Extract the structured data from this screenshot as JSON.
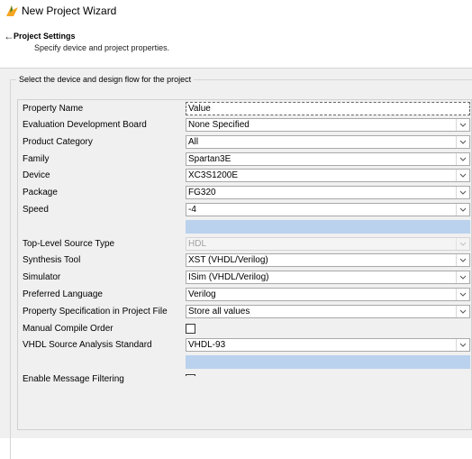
{
  "window": {
    "title": "New Project Wizard",
    "icon": "xilinx-wizard-icon",
    "accent": "#f5a623"
  },
  "header": {
    "back_icon": "back-arrow-icon",
    "title": "Project Settings",
    "subtitle": "Specify device and project properties."
  },
  "group": {
    "legend": "Select the device and design flow for the project"
  },
  "grid": {
    "column_headers": {
      "name": "Property Name",
      "value": "Value"
    },
    "rows": [
      {
        "name": "Evaluation Development Board",
        "value": "None Specified",
        "kind": "dropdown"
      },
      {
        "name": "Product Category",
        "value": "All",
        "kind": "dropdown"
      },
      {
        "name": "Family",
        "value": "Spartan3E",
        "kind": "dropdown"
      },
      {
        "name": "Device",
        "value": "XC3S1200E",
        "kind": "dropdown"
      },
      {
        "name": "Package",
        "value": "FG320",
        "kind": "dropdown"
      },
      {
        "name": "Speed",
        "value": "-4",
        "kind": "dropdown"
      },
      {
        "name": "",
        "value": "",
        "kind": "spacer"
      },
      {
        "name": "Top-Level Source Type",
        "value": "HDL",
        "kind": "dropdown-disabled"
      },
      {
        "name": "Synthesis Tool",
        "value": "XST (VHDL/Verilog)",
        "kind": "dropdown"
      },
      {
        "name": "Simulator",
        "value": "ISim (VHDL/Verilog)",
        "kind": "dropdown"
      },
      {
        "name": "Preferred Language",
        "value": "Verilog",
        "kind": "dropdown"
      },
      {
        "name": "Property Specification in Project File",
        "value": "Store all values",
        "kind": "dropdown"
      },
      {
        "name": "Manual Compile Order",
        "value": false,
        "kind": "checkbox"
      },
      {
        "name": "VHDL Source Analysis Standard",
        "value": "VHDL-93",
        "kind": "dropdown"
      },
      {
        "name": "",
        "value": "",
        "kind": "spacer"
      },
      {
        "name": "Enable Message Filtering",
        "value": false,
        "kind": "checkbox"
      }
    ],
    "selection_color": "#bad2ee"
  }
}
